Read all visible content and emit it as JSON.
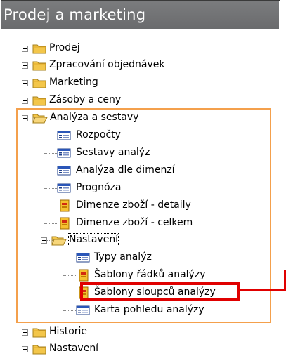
{
  "window": {
    "title": "Prodej a marketing"
  },
  "tree": {
    "prodej": "Prodej",
    "zpracovani": "Zpracování objednávek",
    "marketing": "Marketing",
    "zasoby": "Zásoby a ceny",
    "analyza": "Analýza a sestavy",
    "rozpocty": "Rozpočty",
    "sestavy_analyz": "Sestavy analýz",
    "analyza_dle_dimenzi": "Analýza dle dimenzí",
    "prognoza": "Prognóza",
    "dimenze_detaily": "Dimenze zboží - detaily",
    "dimenze_celkem": "Dimenze zboží - celkem",
    "nastaveni_sub": "Nastavení",
    "typy_analyz": "Typy analýz",
    "sablony_radku": "Šablony řádků analýzy",
    "sablony_sloupcu": "Šablony sloupců analýzy",
    "karta_pohledu": "Karta pohledu analýzy",
    "historie": "Historie",
    "nastaveni": "Nastavení"
  },
  "colors": {
    "title_bar": "#6f7072",
    "folder": "#f3c64a",
    "highlight_orange": "#f4a04c",
    "highlight_red": "#e00000"
  }
}
